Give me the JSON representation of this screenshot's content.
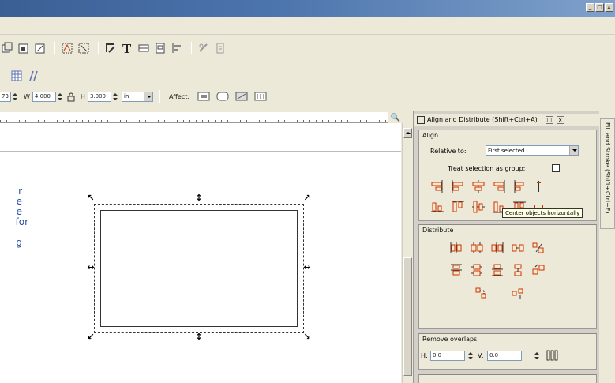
{
  "window": {
    "controls": [
      "_",
      "□",
      "x"
    ]
  },
  "toolbar_coords": {
    "x_value": "73",
    "w_label": "W",
    "w_value": "4.000",
    "h_label": "H",
    "h_value": "3.000",
    "unit": "in",
    "affect_label": "Affect:"
  },
  "caption_lines": [
    "r",
    "e",
    "e",
    "for",
    "",
    "g"
  ],
  "ruler": {
    "zoom_icon": "magnifier-icon"
  },
  "align_panel": {
    "title": "Align and Distribute (Shift+Ctrl+A)",
    "side_tab_label": "Fill and Stroke (Shift+Ctrl+F)",
    "align_group": {
      "title": "Align",
      "relative_to_label": "Relative to:",
      "relative_to_value": "First selected",
      "treat_as_group_label": "Treat selection as group:"
    },
    "tooltip": "Center objects horizontally",
    "distribute_group": {
      "title": "Distribute"
    },
    "remove_overlaps_group": {
      "title": "Remove overlaps",
      "h_label": "H:",
      "h_value": "0.0",
      "v_label": "V:",
      "v_value": "0.0"
    }
  },
  "colors": {
    "accent": "#cc3300",
    "titlebar": "#3a5f95",
    "caption_text": "#2a4e9a"
  }
}
